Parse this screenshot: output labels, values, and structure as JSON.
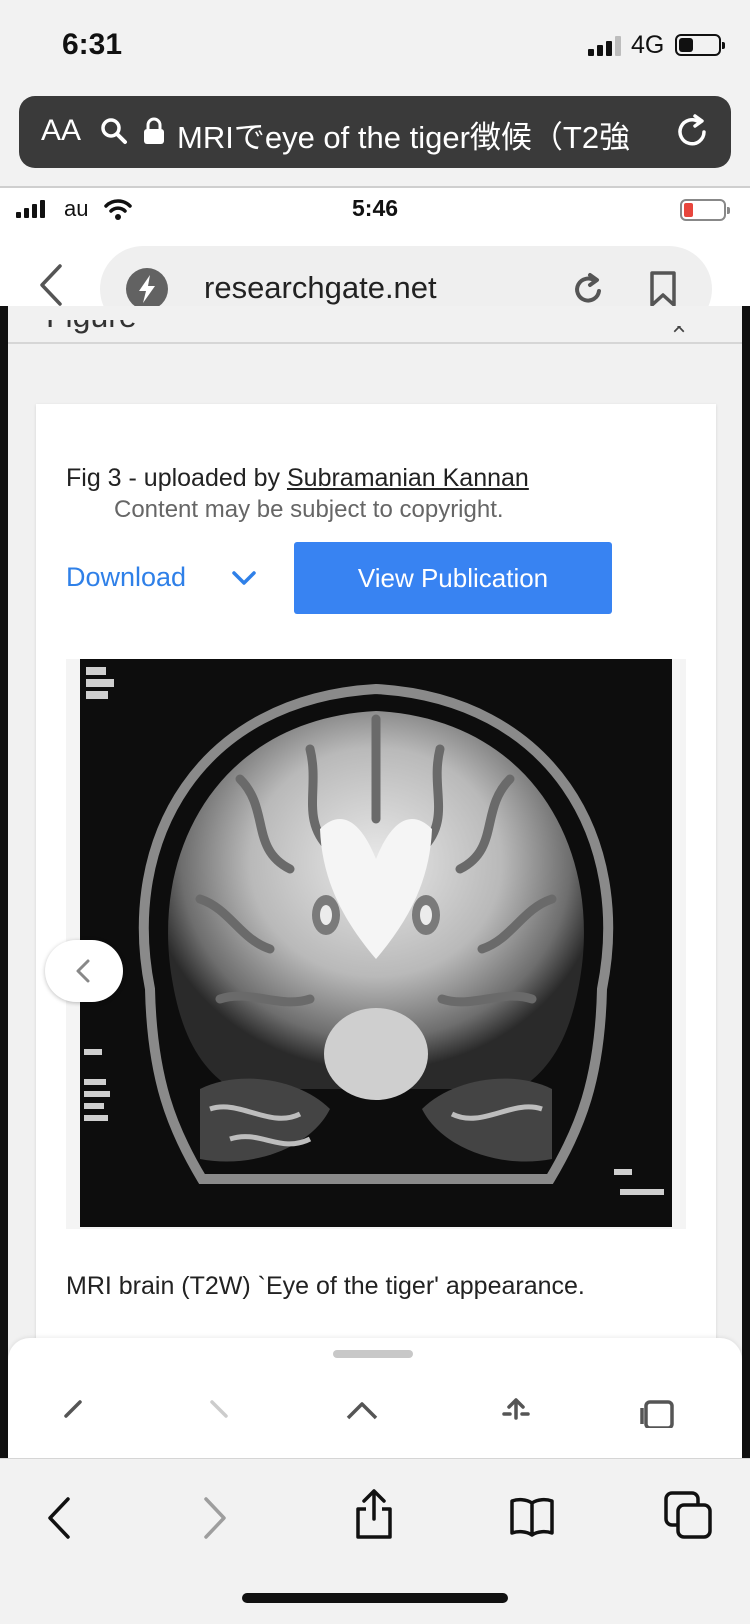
{
  "outer_status": {
    "time": "6:31",
    "network": "4G"
  },
  "outer_address_bar": {
    "text_size_label": "AA",
    "url_title": "MRIでeye of the tiger徴候（T2強"
  },
  "inner_status": {
    "carrier": "au",
    "time": "5:46"
  },
  "inner_browser": {
    "domain": "researchgate.net"
  },
  "page": {
    "section_heading": "Figure",
    "close_glyph": "×",
    "figure": {
      "uploaded_prefix": "Fig 3 - uploaded by ",
      "uploader": "Subramanian Kannan",
      "copyright_note": "Content may be subject to copyright.",
      "download_label": "Download",
      "view_publication_label": "View Publication",
      "caption": "MRI brain (T2W) `Eye of the tiger' appearance."
    }
  },
  "icons": {
    "outer_search": "search-icon",
    "outer_lock": "lock-icon",
    "outer_reload": "reload-icon",
    "inner_back": "chevron-left-icon",
    "inner_amp": "lightning-icon",
    "inner_refresh": "refresh-icon",
    "inner_bookmark": "bookmark-icon",
    "toolbar": [
      "back-icon",
      "forward-icon",
      "share-icon",
      "book-icon",
      "tabs-icon"
    ]
  },
  "colors": {
    "accent_blue": "#3883f2",
    "link_blue": "#2f80e8",
    "battery_low": "#e8463d",
    "address_bar_bg": "#3a3a3a"
  }
}
